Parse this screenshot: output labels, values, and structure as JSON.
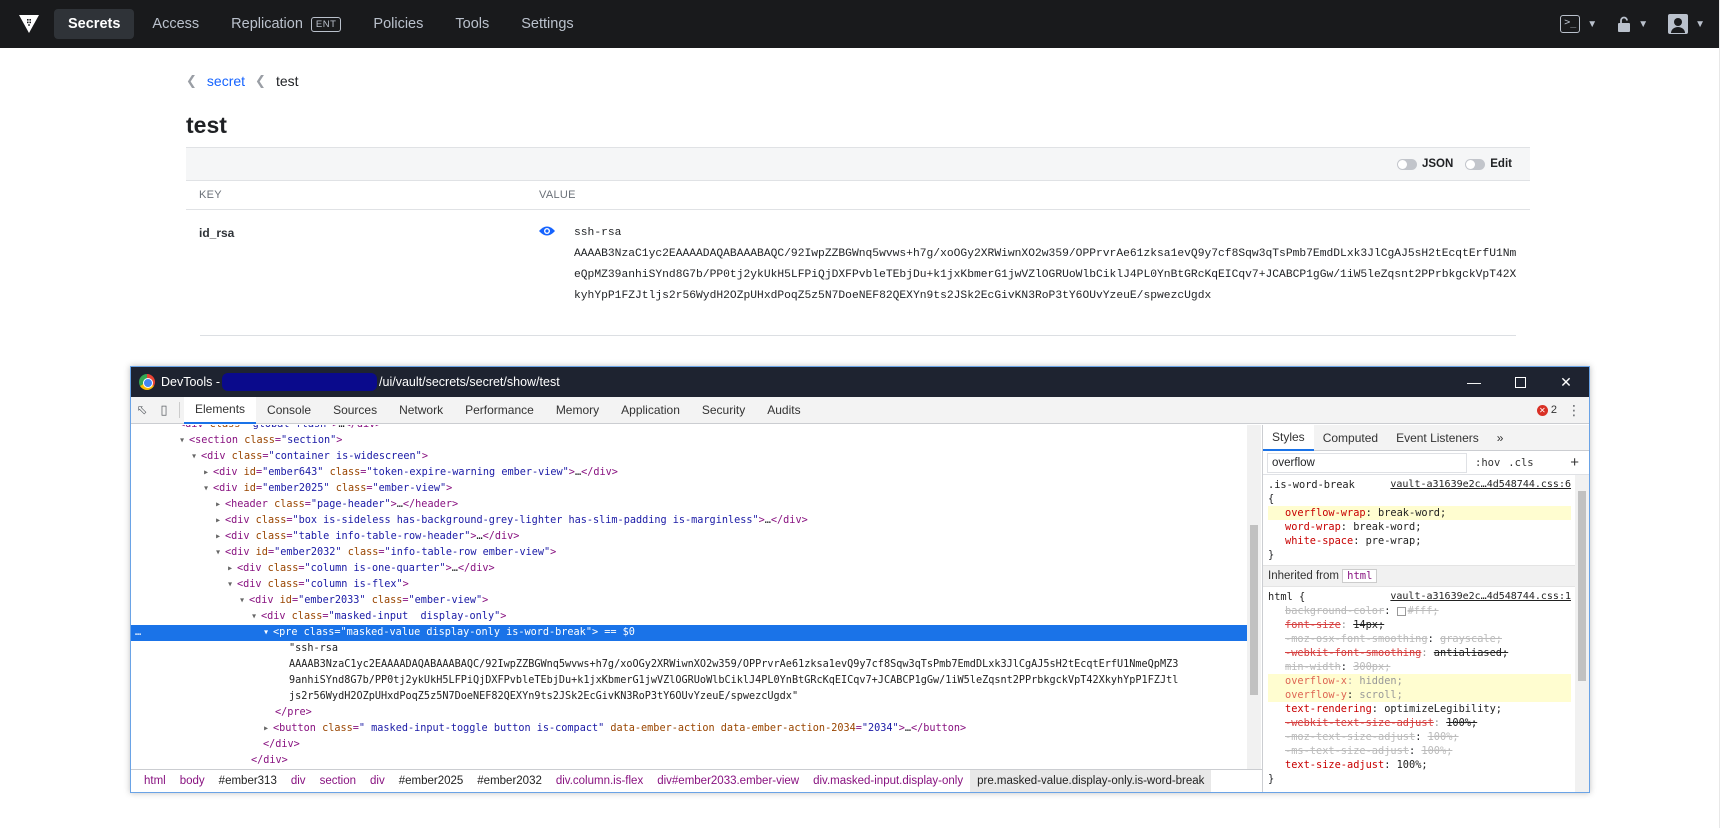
{
  "nav": {
    "items": [
      {
        "label": "Secrets",
        "active": true
      },
      {
        "label": "Access"
      },
      {
        "label": "Replication",
        "badge": "ENT"
      },
      {
        "label": "Policies"
      },
      {
        "label": "Tools"
      },
      {
        "label": "Settings"
      }
    ],
    "right_icons": [
      "console-icon",
      "lock-icon",
      "user-icon"
    ]
  },
  "breadcrumb": {
    "items": [
      "secret",
      "test"
    ]
  },
  "page_title": "test",
  "toolbar": {
    "json_label": "JSON",
    "edit_label": "Edit"
  },
  "table": {
    "key_header": "KEY",
    "value_header": "VALUE",
    "row": {
      "key": "id_rsa",
      "value": "ssh-rsa\nAAAAB3NzaC1yc2EAAAADAQABAAABAQC/92IwpZZBGWnq5wvws+h7g/xoOGy2XRWiwnXO2w359/OPPrvrAe61zksa1evQ9y7cf8Sqw3qTsPmb7EmdDLxk3JlCgAJ5sH2tEcqtErfU1NmeQpMZ39anhiSYnd8G7b/PP0tj2ykUkH5LFPiQjDXFPvbleTEbjDu+k1jxKbmerG1jwVZlOGRUoWlbCiklJ4PL0YnBtGRcKqEICqv7+JCABCP1gGw/1iW5leZqsnt2PPrbkgckVpT42XkyhYpP1FZJtljs2r56WydH2OZpUHxdPoqZ5z5N7DoeNEF82QEXYn9ts2JSk2EcGivKN3RoP3tY6OUvYzeuE/spwezcUgdx"
    }
  },
  "devtools": {
    "title_prefix": "DevTools -",
    "title_suffix": "/ui/vault/secrets/secret/show/test",
    "tabs": [
      "Elements",
      "Console",
      "Sources",
      "Network",
      "Performance",
      "Memory",
      "Application",
      "Security",
      "Audits"
    ],
    "error_count": "2",
    "dom_value_text": "\"ssh-rsa\nAAAAB3NzaC1yc2EAAAADAQABAAABAQC/92IwpZZBGWnq5wvws+h7g/xoOGy2XRWiwnXO2w359/OPPrvrAe61zksa1evQ9y7cf8Sqw3qTsPmb7EmdDLxk3JlCgAJ5sH2tEcqtErfU1NmeQpMZ3\n9anhiSYnd8G7b/PP0tj2ykUkH5LFPiQjDXFPvbleTEbjDu+k1jxKbmerG1jwVZlOGRUoWlbCiklJ4PL0YnBtGRcKqEICqv7+JCABCP1gGw/1iW5leZqsnt2PPrbkgckVpT42XkyhYpP1FZJtl\njs2r56WydH2OZpUHxdPoqZ5z5N7DoeNEF82QEXYn9ts2JSk2EcGivKN3RoP3tY6OUvYzeuE/spwezcUgdx\"",
    "breadcrumbs": [
      "html",
      "body",
      "#ember313",
      "div",
      "section",
      "div",
      "#ember2025",
      "#ember2032",
      "div.column.is-flex",
      "div#ember2033.ember-view",
      "div.masked-input.display-only",
      "pre.masked-value.display-only.is-word-break"
    ],
    "styles": {
      "tabs": [
        "Styles",
        "Computed",
        "Event Listeners"
      ],
      "more": "»",
      "filter_value": "overflow",
      "hov": ":hov",
      "cls": ".cls",
      "plus": "+",
      "rule1": {
        "selector": ".is-word-break",
        "source": "vault-a31639e2c…4d548744.css:6",
        "open": "{",
        "close": "}",
        "decls": [
          {
            "prop": "overflow-wrap",
            "val": "break-word;"
          },
          {
            "prop": "word-wrap",
            "val": "break-word;"
          },
          {
            "prop": "white-space",
            "val": "pre-wrap;"
          }
        ]
      },
      "inherited_label": "Inherited from",
      "inherited_tag": "html",
      "rule2": {
        "selector": "html {",
        "source": "vault-a31639e2c…4d548744.css:1",
        "close": "}",
        "decls": [
          {
            "prop": "background-color",
            "val": "#fff;"
          },
          {
            "prop": "font-size",
            "val": "14px;"
          },
          {
            "prop": "-moz-osx-font-smoothing",
            "val": "grayscale;"
          },
          {
            "prop": "-webkit-font-smoothing",
            "val": "antialiased;"
          },
          {
            "prop": "min-width",
            "val": "300px;"
          },
          {
            "prop": "overflow-x",
            "val": "hidden;"
          },
          {
            "prop": "overflow-y",
            "val": "scroll;"
          },
          {
            "prop": "text-rendering",
            "val": "optimizeLegibility;"
          },
          {
            "prop": "-webkit-text-size-adjust",
            "val": "100%;"
          },
          {
            "prop": "-moz-text-size-adjust",
            "val": "100%;"
          },
          {
            "prop": "-ms-text-size-adjust",
            "val": "100%;"
          },
          {
            "prop": "text-size-adjust",
            "val": "100%;"
          }
        ]
      }
    }
  }
}
